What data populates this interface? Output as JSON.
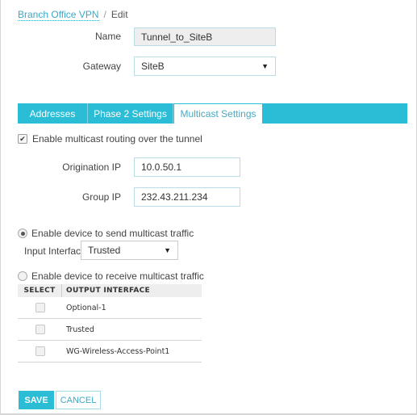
{
  "breadcrumb": {
    "parent": "Branch Office VPN",
    "separator": "/",
    "current": "Edit"
  },
  "form": {
    "name_label": "Name",
    "name_value": "Tunnel_to_SiteB",
    "gateway_label": "Gateway",
    "gateway_value": "SiteB"
  },
  "tabs": [
    {
      "label": "Addresses",
      "active": false
    },
    {
      "label": "Phase 2 Settings",
      "active": false
    },
    {
      "label": "Multicast Settings",
      "active": true
    }
  ],
  "multicast": {
    "enable_label": "Enable multicast routing over the tunnel",
    "enable_checked": true,
    "origination_ip_label": "Origination IP",
    "origination_ip_value": "10.0.50.1",
    "group_ip_label": "Group IP",
    "group_ip_value": "232.43.211.234",
    "send_label": "Enable device to send multicast traffic",
    "send_selected": true,
    "input_interface_label": "Input Interface",
    "input_interface_value": "Trusted",
    "receive_label": "Enable device to receive multicast traffic",
    "receive_selected": false
  },
  "output_table": {
    "columns": [
      "SELECT",
      "OUTPUT INTERFACE"
    ],
    "rows": [
      {
        "checked": false,
        "interface": "Optional-1"
      },
      {
        "checked": false,
        "interface": "Trusted"
      },
      {
        "checked": false,
        "interface": "WG-Wireless-Access-Point1"
      }
    ]
  },
  "buttons": {
    "save": "SAVE",
    "cancel": "CANCEL"
  },
  "icons": {
    "dropdown": "▼",
    "checkmark": "✔"
  },
  "colors": {
    "accent": "#2bbcd6",
    "link": "#3aa9c5"
  }
}
